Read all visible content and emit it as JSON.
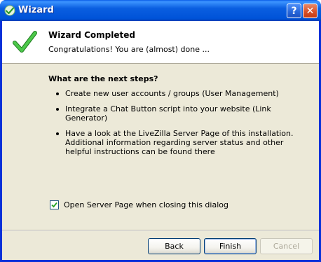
{
  "window": {
    "title": "Wizard"
  },
  "titlebar": {
    "help_label": "?",
    "close_label": "✕"
  },
  "header": {
    "title": "Wizard Completed",
    "subtitle": "Congratulations! You are (almost) done ..."
  },
  "steps": {
    "heading": "What are the next steps?",
    "items": [
      "Create new user accounts / groups (User Management)",
      "Integrate a Chat Button script into your website (Link Generator)",
      "Have a look at the LiveZilla Server Page of this installation. Additional information regarding server status and other helpful instructions can be found there"
    ]
  },
  "option": {
    "label": "Open Server Page when closing this dialog",
    "checked": true
  },
  "buttons": {
    "back": "Back",
    "finish": "Finish",
    "cancel": "Cancel"
  },
  "colors": {
    "titlebar": "#0a5ee0",
    "dialog_bg": "#ece9d8",
    "check_green": "#35b533"
  }
}
